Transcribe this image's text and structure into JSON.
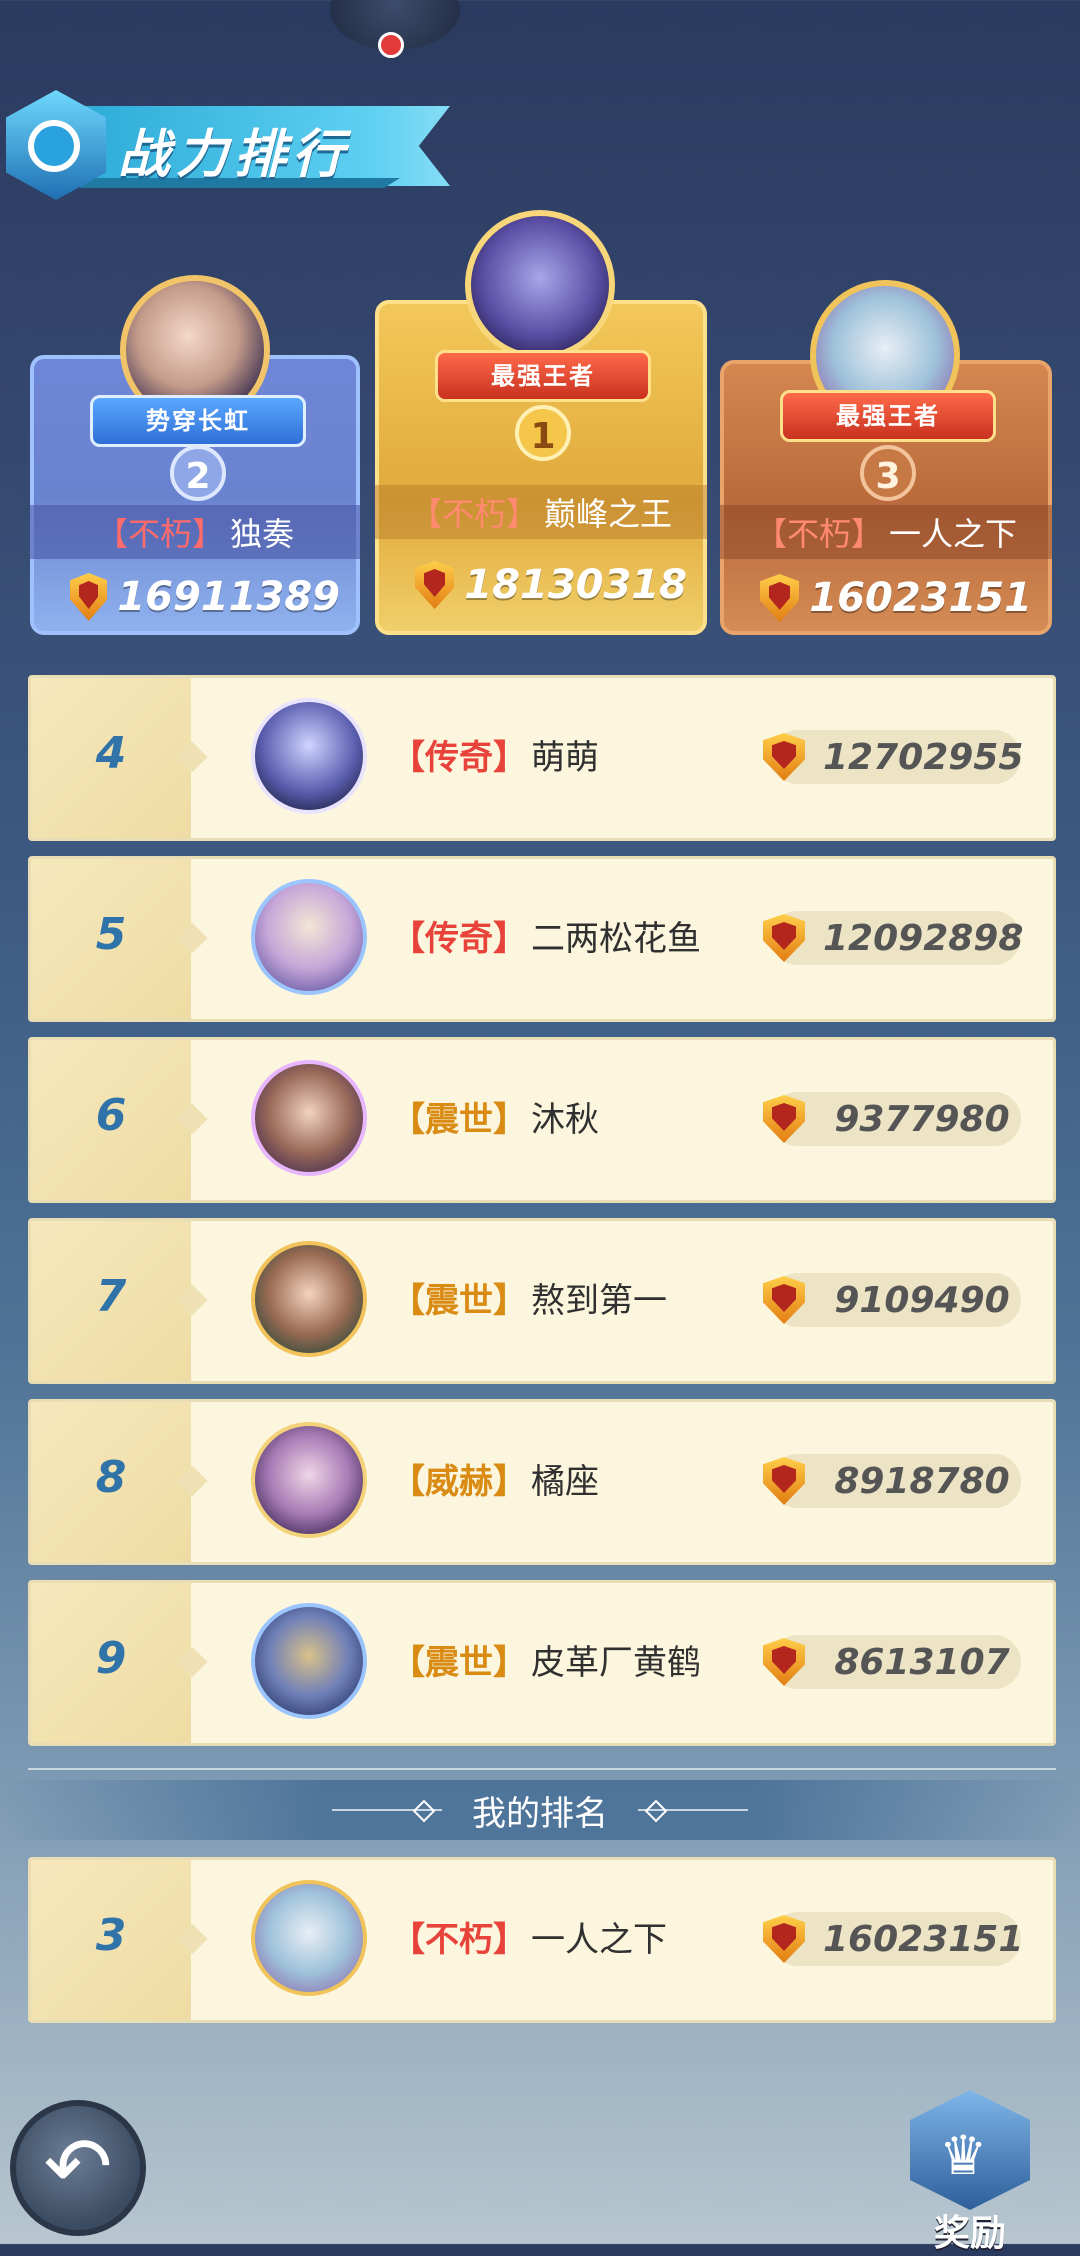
{
  "header": {
    "title": "战力排行"
  },
  "podium": [
    {
      "place": "2",
      "title_badge": "势穿长虹",
      "guild": "【不朽】",
      "name": "独奏",
      "power": "16911389"
    },
    {
      "place": "1",
      "title_badge": "最强王者",
      "guild": "【不朽】",
      "name": "巅峰之王",
      "power": "18130318"
    },
    {
      "place": "3",
      "title_badge": "最强王者",
      "guild": "【不朽】",
      "name": "一人之下",
      "power": "16023151"
    }
  ],
  "rows": [
    {
      "rank": "4",
      "guild": "【传奇】",
      "name": "萌萌",
      "power": "12702955"
    },
    {
      "rank": "5",
      "guild": "【传奇】",
      "name": "二两松花鱼",
      "power": "12092898"
    },
    {
      "rank": "6",
      "guild": "【震世】",
      "name": "沐秋",
      "power": "9377980"
    },
    {
      "rank": "7",
      "guild": "【震世】",
      "name": "熬到第一",
      "power": "9109490"
    },
    {
      "rank": "8",
      "guild": "【威赫】",
      "name": "橘座",
      "power": "8918780"
    },
    {
      "rank": "9",
      "guild": "【震世】",
      "name": "皮革厂黄鹤",
      "power": "8613107"
    }
  ],
  "my_rank": {
    "label": "我的排名",
    "rank": "3",
    "guild": "【不朽】",
    "name": "一人之下",
    "power": "16023151"
  },
  "footer": {
    "reward_label": "奖励"
  }
}
